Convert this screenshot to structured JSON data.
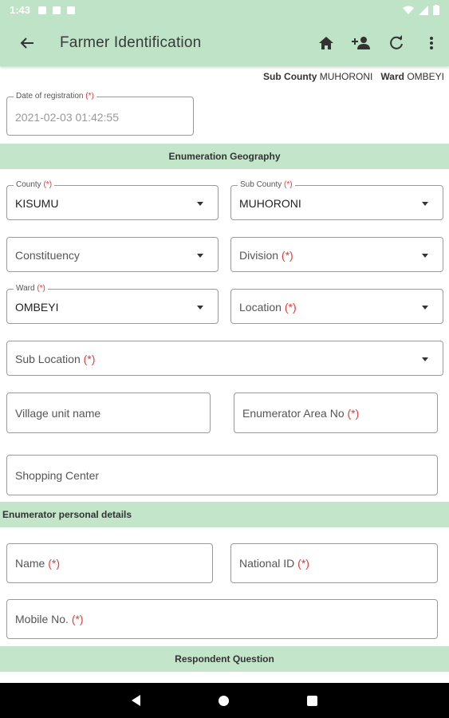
{
  "status_bar": {
    "time": "1:43"
  },
  "app_bar": {
    "title": "Farmer Identification",
    "icons": [
      "back-arrow-icon",
      "home-icon",
      "add-person-icon",
      "refresh-icon",
      "more-vert-icon"
    ]
  },
  "location_line": {
    "sub_county_label": "Sub County",
    "sub_county_value": "MUHORONI",
    "ward_label": "Ward",
    "ward_value": "OMBEYI"
  },
  "registration": {
    "label": "Date of registration",
    "required": "(*)",
    "value": "2021-02-03 01:42:55"
  },
  "sections": {
    "enumeration_geography": "Enumeration Geography",
    "enumerator_personal": "Enumerator personal details",
    "respondent_question": "Respondent Question"
  },
  "geography": {
    "county": {
      "label": "County",
      "required": "(*)",
      "value": "KISUMU"
    },
    "sub_county": {
      "label": "Sub County",
      "required": "(*)",
      "value": "MUHORONI"
    },
    "constituency": {
      "hint": "Constituency"
    },
    "division": {
      "hint": "Division",
      "required": "(*)"
    },
    "ward": {
      "label": "Ward",
      "required": "(*)",
      "value": "OMBEYI"
    },
    "location": {
      "hint": "Location",
      "required": "(*)"
    },
    "sub_location": {
      "hint": "Sub Location",
      "required": "(*)"
    },
    "village_unit": {
      "hint": "Village unit name"
    },
    "enumerator_area": {
      "hint": "Enumerator Area No",
      "required": "(*)"
    },
    "shopping_center": {
      "hint": "Shopping Center"
    }
  },
  "enumerator": {
    "name": {
      "hint": "Name",
      "required": "(*)"
    },
    "national_id": {
      "hint": "National ID",
      "required": "(*)"
    },
    "mobile": {
      "hint": "Mobile No.",
      "required": "(*)"
    }
  },
  "colors": {
    "app_bar": "#bfe3c6",
    "band": "#c3e6cb",
    "required": "#e53935"
  }
}
